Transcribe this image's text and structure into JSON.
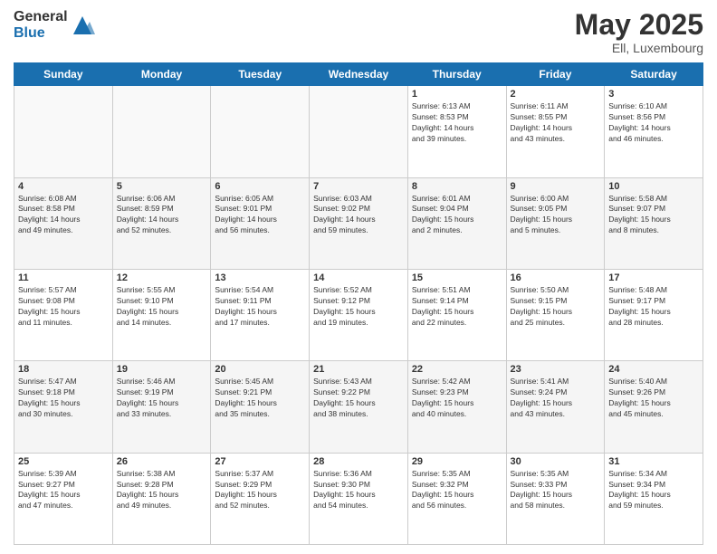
{
  "logo": {
    "general": "General",
    "blue": "Blue"
  },
  "title": "May 2025",
  "location": "Ell, Luxembourg",
  "days_of_week": [
    "Sunday",
    "Monday",
    "Tuesday",
    "Wednesday",
    "Thursday",
    "Friday",
    "Saturday"
  ],
  "weeks": [
    [
      {
        "day": "",
        "info": ""
      },
      {
        "day": "",
        "info": ""
      },
      {
        "day": "",
        "info": ""
      },
      {
        "day": "",
        "info": ""
      },
      {
        "day": "1",
        "info": "Sunrise: 6:13 AM\nSunset: 8:53 PM\nDaylight: 14 hours\nand 39 minutes."
      },
      {
        "day": "2",
        "info": "Sunrise: 6:11 AM\nSunset: 8:55 PM\nDaylight: 14 hours\nand 43 minutes."
      },
      {
        "day": "3",
        "info": "Sunrise: 6:10 AM\nSunset: 8:56 PM\nDaylight: 14 hours\nand 46 minutes."
      }
    ],
    [
      {
        "day": "4",
        "info": "Sunrise: 6:08 AM\nSunset: 8:58 PM\nDaylight: 14 hours\nand 49 minutes."
      },
      {
        "day": "5",
        "info": "Sunrise: 6:06 AM\nSunset: 8:59 PM\nDaylight: 14 hours\nand 52 minutes."
      },
      {
        "day": "6",
        "info": "Sunrise: 6:05 AM\nSunset: 9:01 PM\nDaylight: 14 hours\nand 56 minutes."
      },
      {
        "day": "7",
        "info": "Sunrise: 6:03 AM\nSunset: 9:02 PM\nDaylight: 14 hours\nand 59 minutes."
      },
      {
        "day": "8",
        "info": "Sunrise: 6:01 AM\nSunset: 9:04 PM\nDaylight: 15 hours\nand 2 minutes."
      },
      {
        "day": "9",
        "info": "Sunrise: 6:00 AM\nSunset: 9:05 PM\nDaylight: 15 hours\nand 5 minutes."
      },
      {
        "day": "10",
        "info": "Sunrise: 5:58 AM\nSunset: 9:07 PM\nDaylight: 15 hours\nand 8 minutes."
      }
    ],
    [
      {
        "day": "11",
        "info": "Sunrise: 5:57 AM\nSunset: 9:08 PM\nDaylight: 15 hours\nand 11 minutes."
      },
      {
        "day": "12",
        "info": "Sunrise: 5:55 AM\nSunset: 9:10 PM\nDaylight: 15 hours\nand 14 minutes."
      },
      {
        "day": "13",
        "info": "Sunrise: 5:54 AM\nSunset: 9:11 PM\nDaylight: 15 hours\nand 17 minutes."
      },
      {
        "day": "14",
        "info": "Sunrise: 5:52 AM\nSunset: 9:12 PM\nDaylight: 15 hours\nand 19 minutes."
      },
      {
        "day": "15",
        "info": "Sunrise: 5:51 AM\nSunset: 9:14 PM\nDaylight: 15 hours\nand 22 minutes."
      },
      {
        "day": "16",
        "info": "Sunrise: 5:50 AM\nSunset: 9:15 PM\nDaylight: 15 hours\nand 25 minutes."
      },
      {
        "day": "17",
        "info": "Sunrise: 5:48 AM\nSunset: 9:17 PM\nDaylight: 15 hours\nand 28 minutes."
      }
    ],
    [
      {
        "day": "18",
        "info": "Sunrise: 5:47 AM\nSunset: 9:18 PM\nDaylight: 15 hours\nand 30 minutes."
      },
      {
        "day": "19",
        "info": "Sunrise: 5:46 AM\nSunset: 9:19 PM\nDaylight: 15 hours\nand 33 minutes."
      },
      {
        "day": "20",
        "info": "Sunrise: 5:45 AM\nSunset: 9:21 PM\nDaylight: 15 hours\nand 35 minutes."
      },
      {
        "day": "21",
        "info": "Sunrise: 5:43 AM\nSunset: 9:22 PM\nDaylight: 15 hours\nand 38 minutes."
      },
      {
        "day": "22",
        "info": "Sunrise: 5:42 AM\nSunset: 9:23 PM\nDaylight: 15 hours\nand 40 minutes."
      },
      {
        "day": "23",
        "info": "Sunrise: 5:41 AM\nSunset: 9:24 PM\nDaylight: 15 hours\nand 43 minutes."
      },
      {
        "day": "24",
        "info": "Sunrise: 5:40 AM\nSunset: 9:26 PM\nDaylight: 15 hours\nand 45 minutes."
      }
    ],
    [
      {
        "day": "25",
        "info": "Sunrise: 5:39 AM\nSunset: 9:27 PM\nDaylight: 15 hours\nand 47 minutes."
      },
      {
        "day": "26",
        "info": "Sunrise: 5:38 AM\nSunset: 9:28 PM\nDaylight: 15 hours\nand 49 minutes."
      },
      {
        "day": "27",
        "info": "Sunrise: 5:37 AM\nSunset: 9:29 PM\nDaylight: 15 hours\nand 52 minutes."
      },
      {
        "day": "28",
        "info": "Sunrise: 5:36 AM\nSunset: 9:30 PM\nDaylight: 15 hours\nand 54 minutes."
      },
      {
        "day": "29",
        "info": "Sunrise: 5:35 AM\nSunset: 9:32 PM\nDaylight: 15 hours\nand 56 minutes."
      },
      {
        "day": "30",
        "info": "Sunrise: 5:35 AM\nSunset: 9:33 PM\nDaylight: 15 hours\nand 58 minutes."
      },
      {
        "day": "31",
        "info": "Sunrise: 5:34 AM\nSunset: 9:34 PM\nDaylight: 15 hours\nand 59 minutes."
      }
    ]
  ]
}
